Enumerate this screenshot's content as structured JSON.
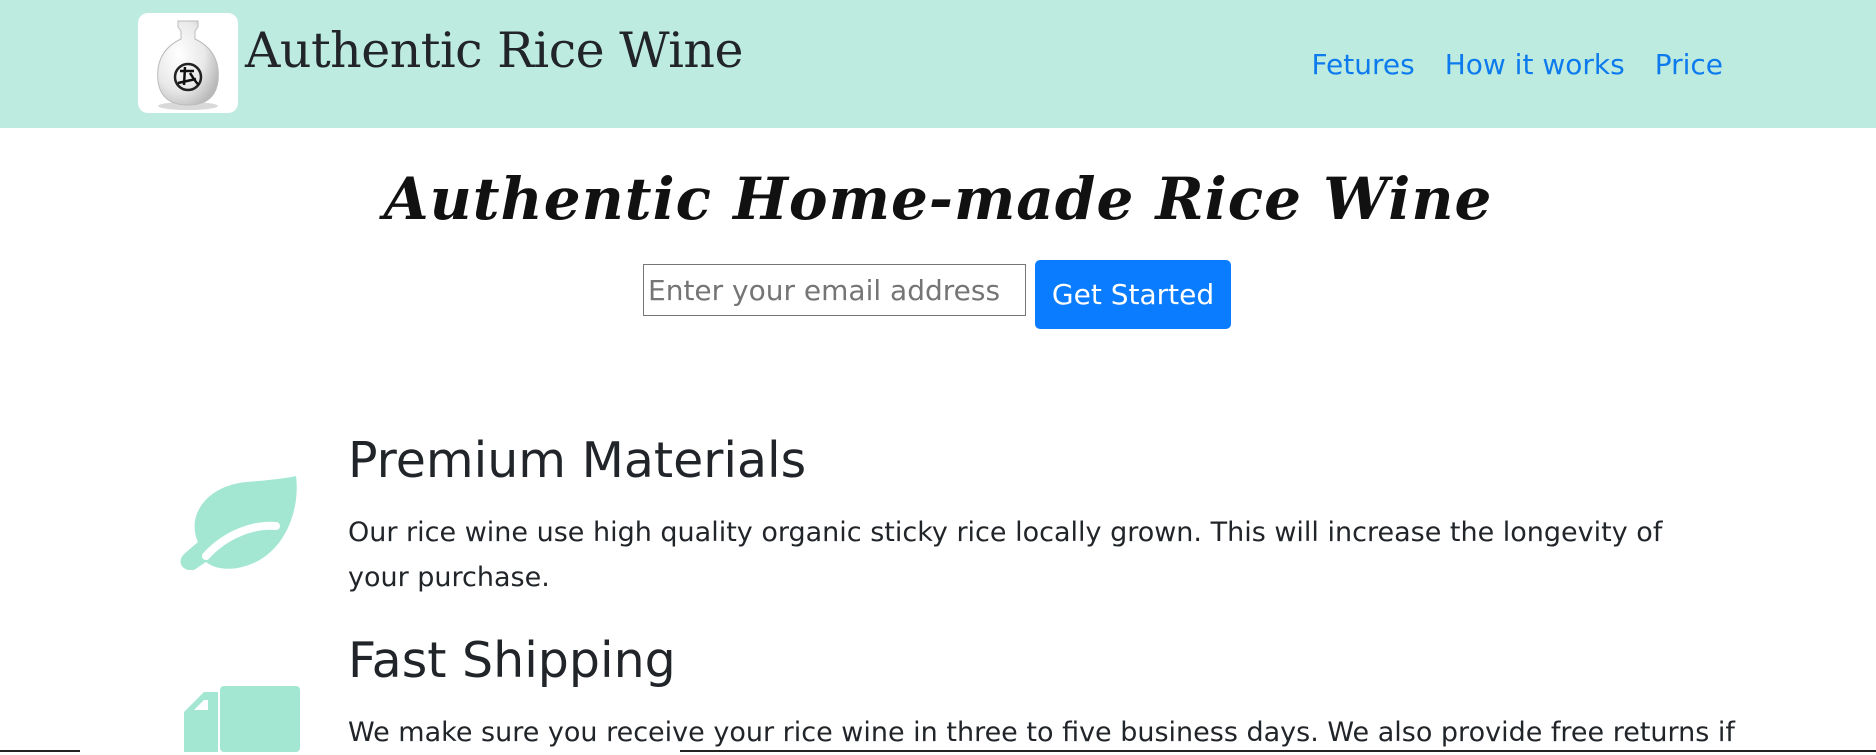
{
  "header": {
    "brand": "Authentic Rice Wine",
    "nav": [
      {
        "label": "Fetures"
      },
      {
        "label": "How it works"
      },
      {
        "label": "Price"
      }
    ]
  },
  "hero": {
    "title": "Authentic Home-made Rice Wine",
    "email_placeholder": "Enter your email address",
    "email_value": "",
    "button_label": "Get Started"
  },
  "features": [
    {
      "icon": "leaf-icon",
      "title": "Premium Materials",
      "text": "Our rice wine use high quality organic sticky rice locally grown. This will increase the longevity of your purchase."
    },
    {
      "icon": "truck-icon",
      "title": "Fast Shipping",
      "text": "We make sure you receive your rice wine in three to five business days. We also provide free returns if"
    }
  ],
  "colors": {
    "header_bg": "#bdebdf",
    "nav_link": "#0d7bee",
    "button_bg": "#0a7cff",
    "icon_mint": "#a3e7d3"
  }
}
